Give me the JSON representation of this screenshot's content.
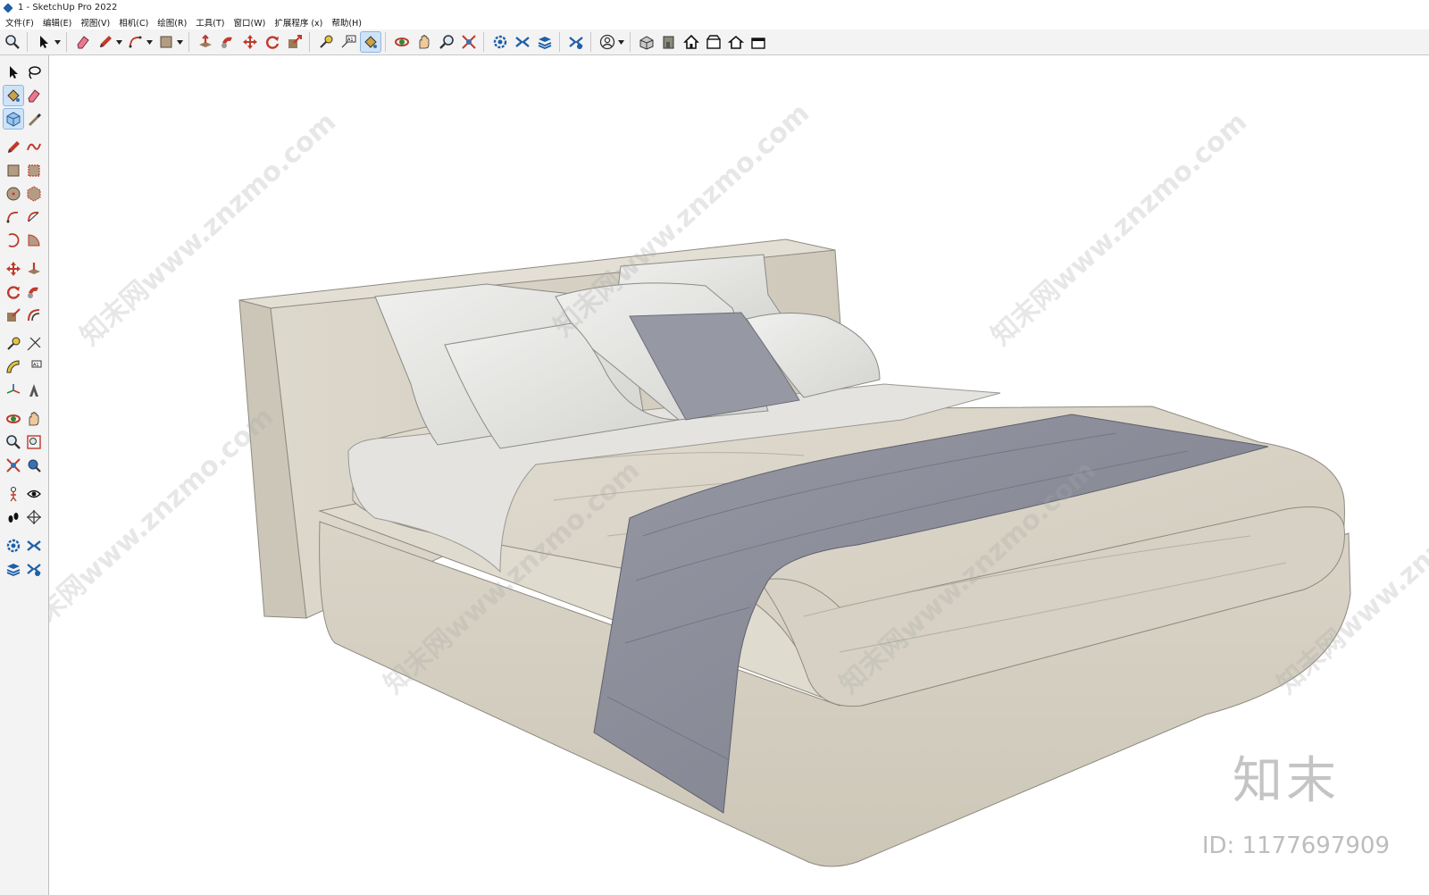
{
  "window": {
    "title": "1 - SketchUp Pro 2022"
  },
  "menu": [
    "文件(F)",
    "编辑(E)",
    "视图(V)",
    "相机(C)",
    "绘图(R)",
    "工具(T)",
    "窗口(W)",
    "扩展程序 (x)",
    "帮助(H)"
  ],
  "toolbar": {
    "icons": [
      "zoom-icon",
      "select-icon",
      "eraser-icon",
      "pencil-icon",
      "arc-icon",
      "rectangle-icon",
      "push-pull-icon",
      "follow-me-icon",
      "move-icon",
      "rotate-icon",
      "scale-icon",
      "tape-measure-icon",
      "text-icon",
      "paint-bucket-icon",
      "orbit-icon",
      "pan-icon",
      "zoom-window-icon",
      "zoom-extents-icon",
      "warehouse-icon",
      "extension-icon",
      "layer-icon",
      "sandbox-icon",
      "profile-icon",
      "iso-view-icon",
      "front-view-icon",
      "home-view-icon",
      "top-view-icon",
      "house-icon",
      "back-view-icon"
    ]
  },
  "watermark": {
    "text": "知末网www.znzmo.com",
    "brand": "知末",
    "id": "ID: 1177697909"
  },
  "colors": {
    "toolbar_bg": "#f3f3f3",
    "fabric_beige": "#d8d3c6",
    "pillow_white": "#e6e6e4",
    "throw_grey": "#8a8c99"
  }
}
